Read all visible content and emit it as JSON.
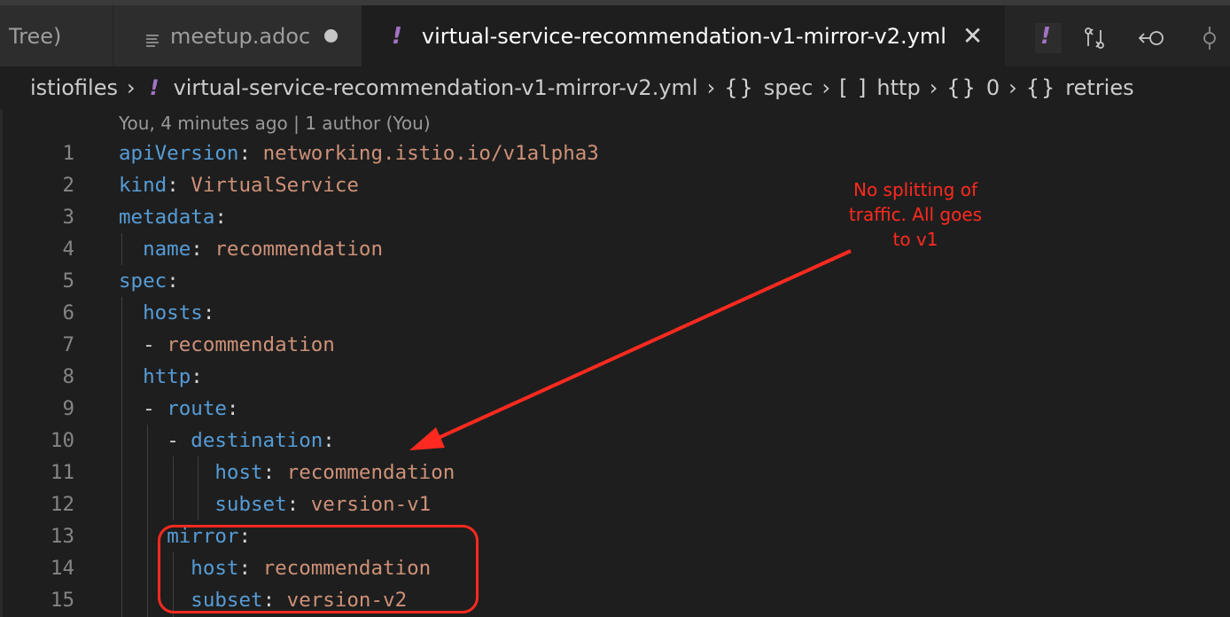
{
  "tabs": [
    {
      "label": "Tree)",
      "active": false
    },
    {
      "label": "meetup.adoc",
      "active": false,
      "modified": true
    },
    {
      "label": "virtual-service-recommendation-v1-mirror-v2.yml",
      "active": true
    }
  ],
  "tab_file_marker": "!",
  "breadcrumb": {
    "folder": "istiofiles",
    "file": "virtual-service-recommendation-v1-mirror-v2.yml",
    "symbols": [
      {
        "icon": "{}",
        "label": "spec"
      },
      {
        "icon": "[ ]",
        "label": "http"
      },
      {
        "icon": "{}",
        "label": "0"
      },
      {
        "icon": "{}",
        "label": "retries"
      }
    ]
  },
  "blame": "You, 4 minutes ago | 1 author (You)",
  "code_lines": [
    {
      "n": "1",
      "indent": "",
      "dash": "",
      "key": "apiVersion",
      "value": "networking.istio.io/v1alpha3"
    },
    {
      "n": "2",
      "indent": "",
      "dash": "",
      "key": "kind",
      "value": "VirtualService"
    },
    {
      "n": "3",
      "indent": "",
      "dash": "",
      "key": "metadata",
      "value": ""
    },
    {
      "n": "4",
      "indent": "  ",
      "dash": "",
      "key": "name",
      "value": "recommendation"
    },
    {
      "n": "5",
      "indent": "",
      "dash": "",
      "key": "spec",
      "value": ""
    },
    {
      "n": "6",
      "indent": "  ",
      "dash": "",
      "key": "hosts",
      "value": ""
    },
    {
      "n": "7",
      "indent": "  ",
      "dash": "- ",
      "key": "",
      "value": "recommendation"
    },
    {
      "n": "8",
      "indent": "  ",
      "dash": "",
      "key": "http",
      "value": ""
    },
    {
      "n": "9",
      "indent": "  ",
      "dash": "- ",
      "key": "route",
      "value": ""
    },
    {
      "n": "10",
      "indent": "    ",
      "dash": "- ",
      "key": "destination",
      "value": ""
    },
    {
      "n": "11",
      "indent": "        ",
      "dash": "",
      "key": "host",
      "value": "recommendation"
    },
    {
      "n": "12",
      "indent": "        ",
      "dash": "",
      "key": "subset",
      "value": "version-v1"
    },
    {
      "n": "13",
      "indent": "    ",
      "dash": "",
      "key": "mirror",
      "value": ""
    },
    {
      "n": "14",
      "indent": "      ",
      "dash": "",
      "key": "host",
      "value": "recommendation"
    },
    {
      "n": "15",
      "indent": "      ",
      "dash": "",
      "key": "subset",
      "value": "version-v2"
    }
  ],
  "annotation": {
    "lines": [
      "No splitting of",
      "traffic. All goes",
      "to v1"
    ],
    "color": "#ff2a1f"
  },
  "colors": {
    "key": "#569cd6",
    "value": "#ce9178",
    "background": "#1e1e1e",
    "line_number": "#858585"
  }
}
